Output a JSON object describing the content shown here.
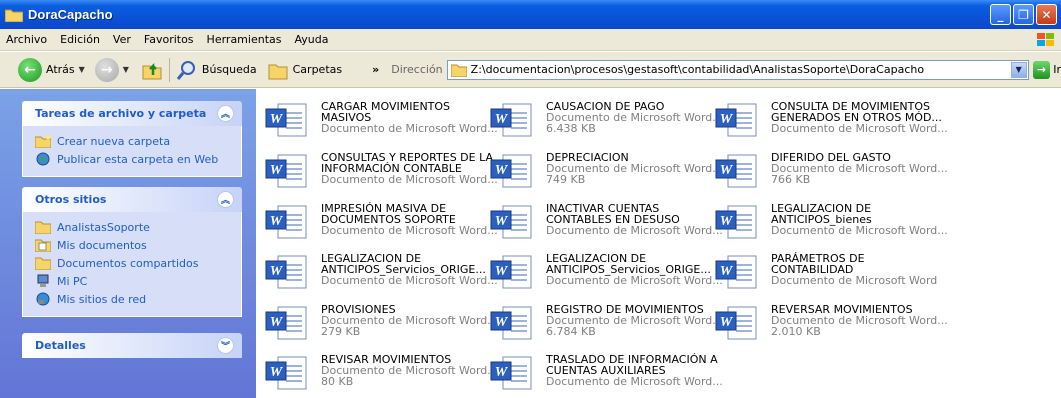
{
  "window": {
    "title": "DoraCapacho"
  },
  "menu": [
    "Archivo",
    "Edición",
    "Ver",
    "Favoritos",
    "Herramientas",
    "Ayuda"
  ],
  "toolbar": {
    "back_label": "Atrás",
    "search_label": "Búsqueda",
    "folders_label": "Carpetas",
    "address_label": "Dirección",
    "address_value": "Z:\\documentacion\\procesos\\gestasoft\\contabilidad\\AnalistasSoporte\\DoraCapacho",
    "go_label": "Ir"
  },
  "left": {
    "tasks": {
      "header": "Tareas de archivo y carpeta",
      "items": [
        "Crear nueva carpeta",
        "Publicar esta carpeta en Web"
      ]
    },
    "places": {
      "header": "Otros sitios",
      "items": [
        "AnalistasSoporte",
        "Mis documentos",
        "Documentos compartidos",
        "Mi PC",
        "Mis sitios de red"
      ]
    },
    "details": {
      "header": "Detalles"
    }
  },
  "files": [
    {
      "name": "CARGAR MOVIMIENTOS\nMASIVOS",
      "type": "Documento de Microsoft Word...",
      "size": ""
    },
    {
      "name": "CAUSACION DE PAGO",
      "type": "Documento de Microsoft Word...",
      "size": "6.438 KB"
    },
    {
      "name": "CONSULTA DE MOVIMIENTOS\nGENERADOS EN OTROS MÓD...",
      "type": "Documento de Microsoft Word...",
      "size": ""
    },
    {
      "name": "CONSULTAS Y REPORTES DE LA\nINFORMACIÓN CONTABLE",
      "type": "Documento de Microsoft Word...",
      "size": ""
    },
    {
      "name": "DEPRECIACION",
      "type": "Documento de Microsoft Word...",
      "size": "749 KB"
    },
    {
      "name": "DIFERIDO DEL GASTO",
      "type": "Documento de Microsoft Word...",
      "size": "766 KB"
    },
    {
      "name": "IMPRESIÓN MASIVA DE\nDOCUMENTOS SOPORTE",
      "type": "Documento de Microsoft Word...",
      "size": ""
    },
    {
      "name": "INACTIVAR CUENTAS\nCONTABLES EN DESUSO",
      "type": "Documento de Microsoft Word...",
      "size": ""
    },
    {
      "name": "LEGALIZACION DE\nANTICIPOS_bienes",
      "type": "Documento de Microsoft Word...",
      "size": ""
    },
    {
      "name": "LEGALIZACION DE\nANTICIPOS_Servicios_ORIGE...",
      "type": "Documento de Microsoft Word...",
      "size": ""
    },
    {
      "name": "LEGALIZACION DE\nANTICIPOS_Servicios_ORIGE...",
      "type": "Documento de Microsoft Word...",
      "size": ""
    },
    {
      "name": "PARÁMETROS DE\nCONTABILIDAD",
      "type": "Documento de Microsoft Word",
      "size": ""
    },
    {
      "name": "PROVISIONES",
      "type": "Documento de Microsoft Word...",
      "size": "279 KB"
    },
    {
      "name": "REGISTRO DE MOVIMIENTOS",
      "type": "Documento de Microsoft Word...",
      "size": "6.784 KB"
    },
    {
      "name": "REVERSAR MOVIMIENTOS",
      "type": "Documento de Microsoft Word...",
      "size": "2.010 KB"
    },
    {
      "name": "REVISAR MOVIMIENTOS",
      "type": "Documento de Microsoft Word...",
      "size": "80 KB"
    },
    {
      "name": "TRASLADO DE INFORMACIÓN A\nCUENTAS AUXILIARES",
      "type": "Documento de Microsoft Word...",
      "size": ""
    }
  ]
}
